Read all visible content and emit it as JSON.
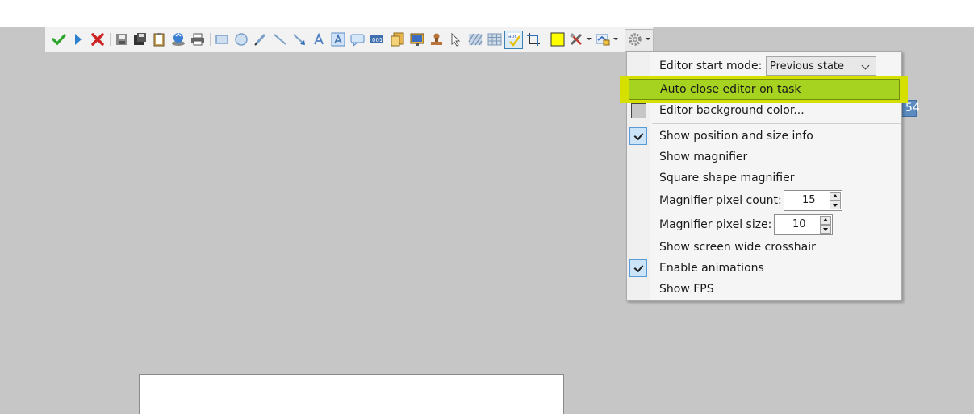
{
  "colors": {
    "background": "#c6c6c6",
    "highlight_outer": "#d5e000",
    "highlight_inner": "#a6d320",
    "current_color": "#ffff00",
    "check_fill": "#cce4f7"
  },
  "toolbar": {
    "icons": [
      "confirm-check-icon",
      "run-icon",
      "cancel-x-icon",
      "save-icon",
      "save-as-icon",
      "clipboard-icon",
      "upload-icon",
      "print-icon",
      "rectangle-icon",
      "ellipse-icon",
      "freehand-icon",
      "line-icon",
      "arrow-icon",
      "text-icon",
      "text-outline-icon",
      "speech-balloon-icon",
      "step-counter-icon",
      "image-icon",
      "sticker-icon",
      "stamp-icon",
      "select-pointer-icon",
      "blur-icon",
      "pixelate-icon",
      "spellcheck-icon",
      "crop-icon",
      "color-icon",
      "tools-icon",
      "image-effects-icon",
      "settings-gear-icon"
    ]
  },
  "menu": {
    "start_mode_label": "Editor start mode:",
    "start_mode_value": "Previous state",
    "auto_close_label": "Auto close editor on task",
    "bg_color_label": "Editor background color...",
    "show_info_label": "Show position and size info",
    "show_info_checked": true,
    "show_magnifier_label": "Show magnifier",
    "square_magnifier_label": "Square shape magnifier",
    "pixel_count_label": "Magnifier pixel count:",
    "pixel_count_value": "15",
    "pixel_size_label": "Magnifier pixel size:",
    "pixel_size_value": "10",
    "crosshair_label": "Show screen wide crosshair",
    "animations_label": "Enable animations",
    "animations_checked": true,
    "fps_label": "Show FPS"
  },
  "badge_text": "54"
}
